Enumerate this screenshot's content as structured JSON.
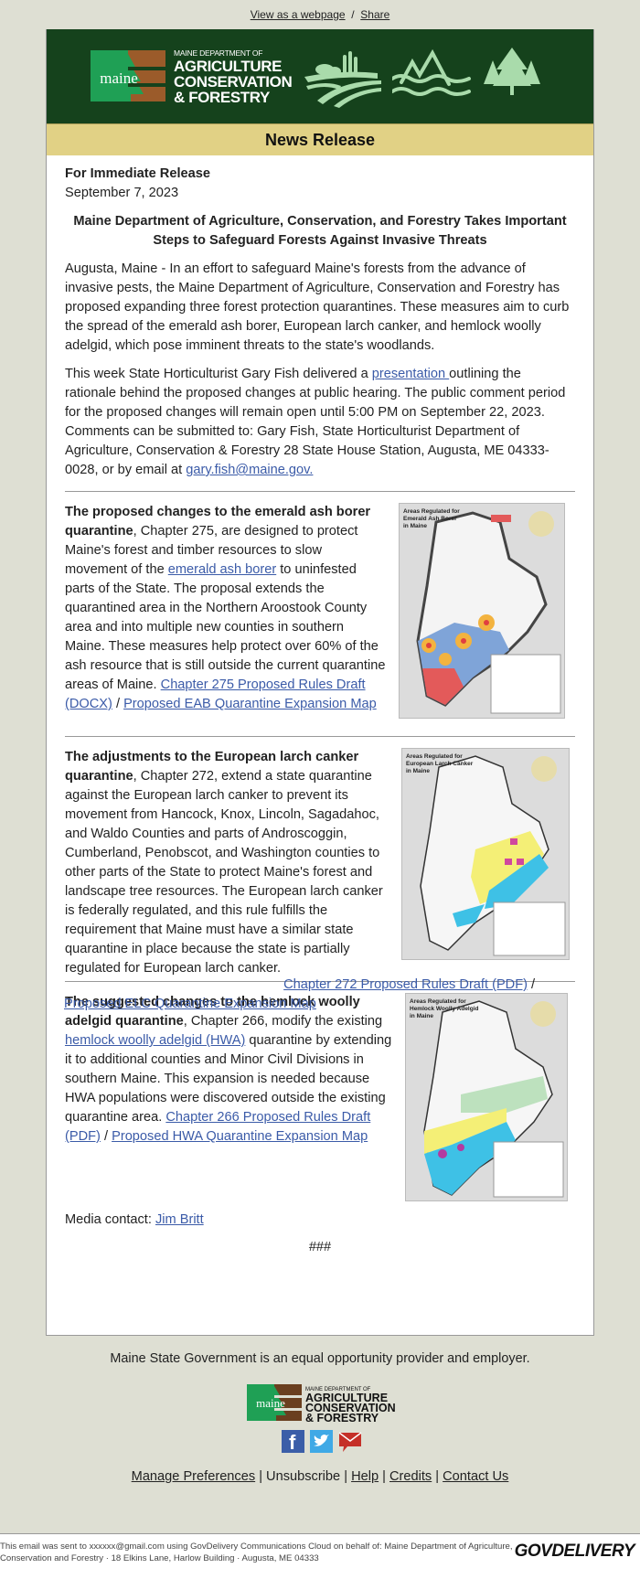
{
  "top_links": {
    "view_webpage": "View as a webpage",
    "separator": "/",
    "share": "Share"
  },
  "banner": {
    "logo_word": "maine",
    "dept_small": "MAINE DEPARTMENT OF",
    "dept_line1": "AGRICULTURE",
    "dept_line2": "CONSERVATION",
    "dept_line3": "& FORESTRY",
    "icons": [
      "farmland-icon",
      "mountain-water-icon",
      "pine-trees-icon"
    ],
    "bg_color": "#15421c",
    "icon_color": "#a9dbab"
  },
  "news_bar": {
    "title": "News Release",
    "bg_color": "#e1d185"
  },
  "release": {
    "label": "For Immediate Release",
    "date": "September 7, 2023",
    "headline": "Maine Department of Agriculture, Conservation, and Forestry Takes Important Steps to Safeguard Forests Against Invasive Threats",
    "intro": "Augusta, Maine - In an effort to safeguard Maine's forests from the advance of invasive pests, the Maine Department of Agriculture, Conservation and Forestry has proposed expanding three forest protection quarantines. These  measures aim to curb the spread of the emerald ash borer, European larch canker, and hemlock woolly adelgid, which pose imminent threats to the state's woodlands.",
    "para2_before": "This week State Horticulturist Gary Fish delivered a ",
    "para2_link": "presentation ",
    "para2_after": "outlining the rationale behind the proposed changes at public hearing. The public comment period for the proposed changes will remain open until 5:00 PM on September 22, 2023. Comments can be submitted to: Gary Fish, State Horticulturist Department of Agriculture, Conservation & Forestry 28 State House Station, Augusta, ME 04333-0028, or by email at ",
    "para2_email": "gary.fish@maine.gov."
  },
  "sections": [
    {
      "bold": "The proposed changes to the emerald ash borer quarantine",
      "text1": ", Chapter 275, are designed to protect Maine's forest and timber resources to slow movement of the ",
      "inline_link": "emerald ash borer",
      "text2": " to uninfested parts of the State. The proposal extends the quarantined area in the Northern Aroostook County area and into multiple new counties in southern Maine. These measures help protect over 60% of the ash resource that is still outside the current quarantine areas of Maine. ",
      "link1": "Chapter 275 Proposed Rules Draft (DOCX)",
      "sep": " / ",
      "link2": "Proposed EAB Quarantine Expansion Map",
      "map_title": "Areas Regulated for Emerald Ash Borer in Maine"
    },
    {
      "bold": "The adjustments to the European larch canker quarantine",
      "text1": ", Chapter 272, extend a state quarantine against the European larch canker to prevent its movement from Hancock, Knox, Lincoln, Sagadahoc, and Waldo Counties and parts of Androscoggin, Cumberland, Penobscot, and Washington counties to other parts of the State to protect Maine's forest and landscape tree resources. The European larch canker is federally regulated, and this rule fulfills the requirement that Maine must have a similar state quarantine in place because the state is partially regulated for European larch canker. ",
      "link1": "Chapter 272 Proposed Rules Draft (PDF)",
      "sep": " /  ",
      "link2": "Proposed ELC Quarantine Expansion Map",
      "map_title": "Areas Regulated for European Larch Canker in Maine"
    },
    {
      "bold": "The suggested changes to the hemlock woolly adelgid quarantine",
      "text1": ", Chapter 266, modify the existing ",
      "inline_link": "hemlock woolly adelgid (HWA)",
      "text2": " quarantine by extending it to additional counties and Minor Civil Divisions in southern Maine. This expansion is needed because HWA populations were discovered outside the existing quarantine area. ",
      "link1": "Chapter 266 Proposed Rules Draft (PDF)",
      "sep": " / ",
      "link2": "Proposed HWA Quarantine Expansion Map",
      "map_title": "Areas Regulated for Hemlock Woolly Adelgid in Maine"
    }
  ],
  "media_contact": {
    "label": "Media contact: ",
    "name": "Jim Britt"
  },
  "end_mark": "###",
  "footer": {
    "equal_opportunity": "Maine State Government is an equal opportunity provider and employer.",
    "social": [
      "facebook-icon",
      "twitter-icon",
      "email-icon"
    ],
    "links": [
      "Manage Preferences",
      "Unsubscribe",
      "Help",
      "Credits",
      "Contact Us"
    ],
    "sent_notice": "This email was sent to xxxxxx@gmail.com using GovDelivery Communications Cloud on behalf of: Maine Department of Agriculture, Conservation and Forestry · 18 Elkins Lane, Harlow Building · Augusta, ME 04333",
    "brand": "GOVDELIVERY"
  }
}
